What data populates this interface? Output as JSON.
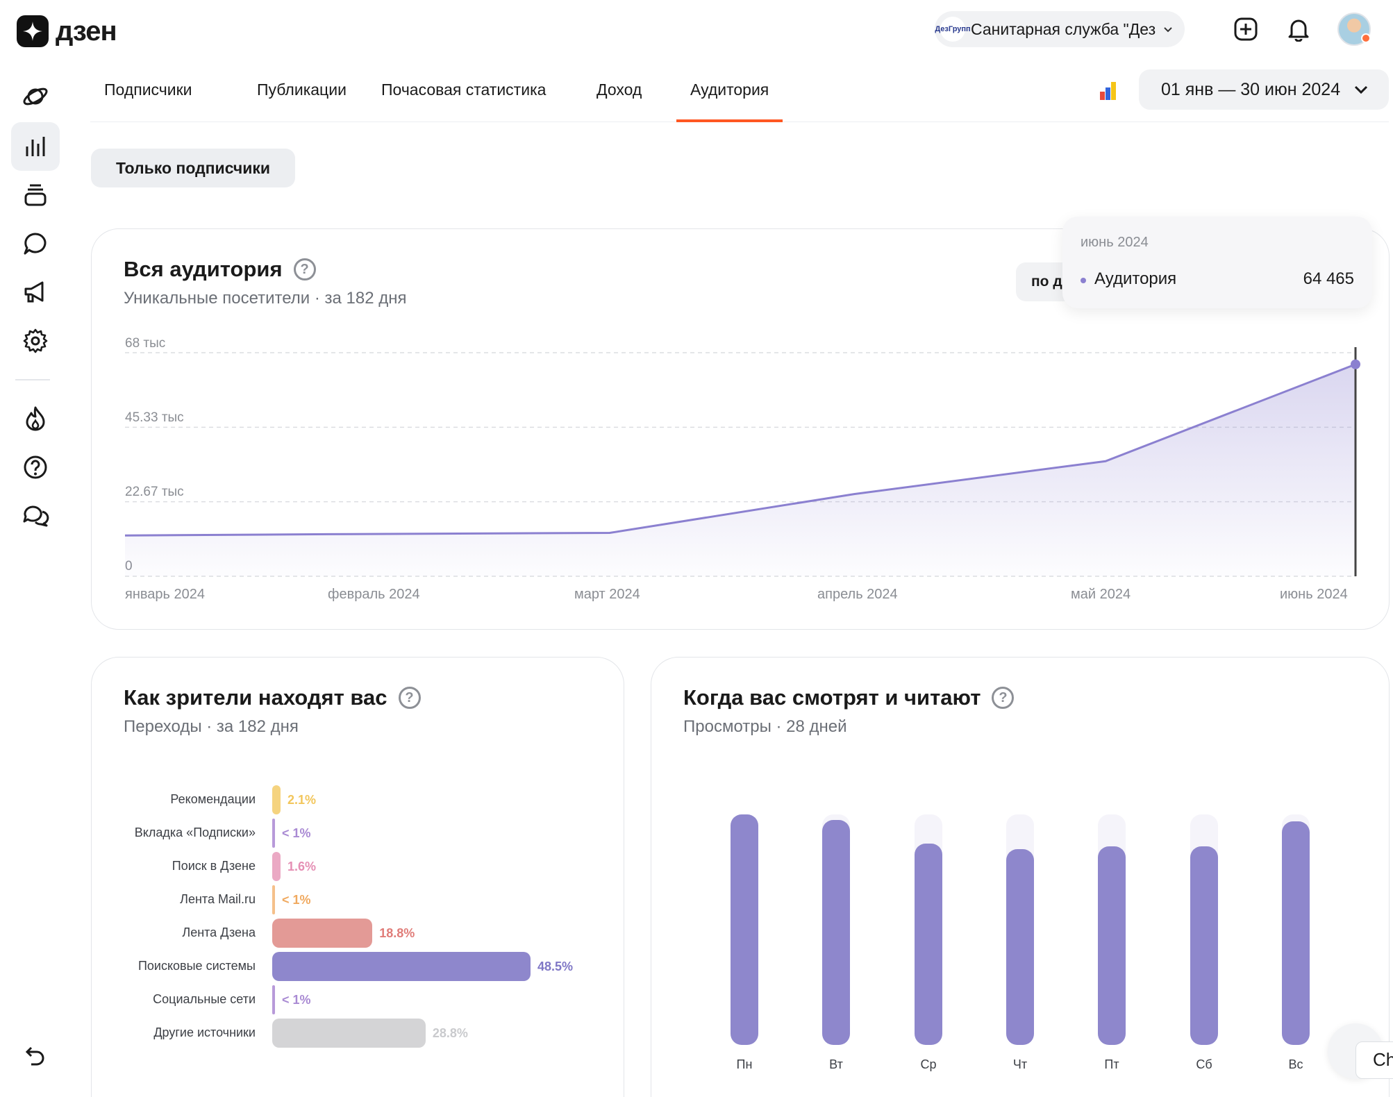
{
  "brand": {
    "name": "дзен"
  },
  "header": {
    "channel_name": "Санитарная служба \"Дез...",
    "channel_avatar_text": "ДезГрупп",
    "icons": [
      "add-post-icon",
      "bell-icon",
      "user-avatar"
    ]
  },
  "sidebar": {
    "items": [
      "planet-icon",
      "stats-icon",
      "layers-icon",
      "comment-icon",
      "megaphone-icon",
      "gear-icon",
      "fire-icon",
      "help-icon",
      "chat-icon"
    ],
    "active": "stats-icon",
    "bottom": "back-icon"
  },
  "tabs": [
    "Подписчики",
    "Публикации",
    "Почасовая статистика",
    "Доход",
    "Аудитория"
  ],
  "active_tab": "Аудитория",
  "date_range": "01 янв — 30 июн 2024",
  "filter": "Только подписчики",
  "audience": {
    "title": "Вся аудитория",
    "subtitle": "Уникальные посетители · за 182 дня",
    "period_button": "по д",
    "tooltip": {
      "date": "июнь 2024",
      "label": "Аудитория",
      "value": "64 465"
    }
  },
  "sources": {
    "title": "Как зрители находят вас",
    "subtitle": "Переходы · за 182 дня"
  },
  "weekly": {
    "title": "Когда вас смотрят и читают",
    "subtitle": "Просмотры · 28 дней"
  },
  "chat_button": "Ch",
  "colors": {
    "accent": "#ff5722",
    "series": "#8b80d0",
    "bar": "#8e87cc"
  },
  "chart_data": [
    {
      "type": "area",
      "title": "Вся аудитория",
      "subtitle": "Уникальные посетители · за 182 дня",
      "y_ticks": [
        "0",
        "22.67 тыс",
        "45.33 тыс",
        "68 тыс"
      ],
      "ylim": [
        0,
        68000
      ],
      "x_ticks": [
        "январь 2024",
        "февраль 2024",
        "март 2024",
        "апрель 2024",
        "май 2024",
        "июнь 2024"
      ],
      "series": [
        {
          "name": "Аудитория",
          "values": [
            12400,
            12800,
            13200,
            25000,
            35000,
            64465
          ]
        }
      ],
      "grid": true
    },
    {
      "type": "bar",
      "orientation": "horizontal",
      "categories": [
        "Рекомендации",
        "Вкладка «Подписки»",
        "Поиск в Дзене",
        "Лента Mail.ru",
        "Лента Дзена",
        "Поисковые системы",
        "Социальные сети",
        "Другие источники"
      ],
      "values": [
        2.1,
        0.5,
        1.6,
        0.5,
        18.8,
        48.5,
        0.5,
        28.8
      ],
      "labels": [
        "2.1%",
        "< 1%",
        "1.6%",
        "< 1%",
        "18.8%",
        "48.5%",
        "< 1%",
        "28.8%"
      ],
      "colors": [
        "#f5d37f",
        "#b89ad9",
        "#eba9c4",
        "#f5c08a",
        "#e39a96",
        "#8e87cc",
        "#b89ad9",
        "#d4d4d6"
      ],
      "label_colors": [
        "#f2c65c",
        "#a98ad3",
        "#e58fb4",
        "#f0a95f",
        "#e07c78",
        "#7f77c6",
        "#a98ad3",
        "#c9cacd"
      ]
    },
    {
      "type": "bar",
      "categories": [
        "Пн",
        "Вт",
        "Ср",
        "Чт",
        "Пт",
        "Сб",
        "Вс"
      ],
      "values": [
        100,
        97.5,
        87.5,
        85,
        86,
        86,
        97
      ]
    }
  ]
}
